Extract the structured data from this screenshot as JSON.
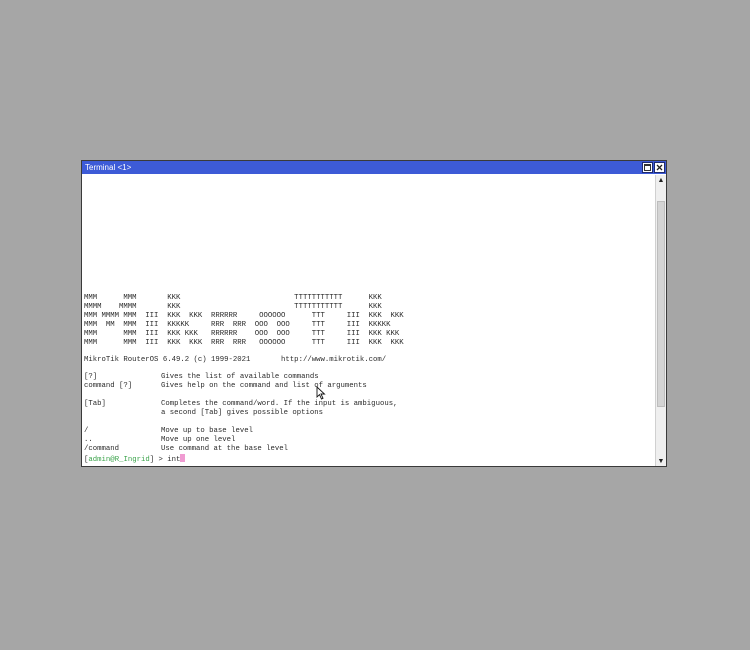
{
  "window": {
    "title": "Terminal <1>"
  },
  "banner": [
    "MMM      MMM       KKK                          TTTTTTTTTTT      KKK",
    "MMMM    MMMM       KKK                          TTTTTTTTTTT      KKK",
    "MMM MMMM MMM  III  KKK  KKK  RRRRRR     OOOOOO      TTT     III  KKK  KKK",
    "MMM  MM  MMM  III  KKKKK     RRR  RRR  OOO  OOO     TTT     III  KKKKK",
    "MMM      MMM  III  KKK KKK   RRRRRR    OOO  OOO     TTT     III  KKK KKK",
    "MMM      MMM  III  KKK  KKK  RRR  RRR   OOOOOO      TTT     III  KKK  KKK"
  ],
  "version_line": "MikroTik RouterOS 6.49.2 (c) 1999-2021       http://www.mikrotik.com/",
  "help": [
    {
      "key": "[?]",
      "desc": "Gives the list of available commands"
    },
    {
      "key": "command [?]",
      "desc": "Gives help on the command and list of arguments"
    },
    {
      "key": "",
      "desc": ""
    },
    {
      "key": "[Tab]",
      "desc": "Completes the command/word. If the input is ambiguous,"
    },
    {
      "key": "",
      "desc": "a second [Tab] gives possible options"
    },
    {
      "key": "",
      "desc": ""
    },
    {
      "key": "/",
      "desc": "Move up to base level"
    },
    {
      "key": "..",
      "desc": "Move up one level"
    },
    {
      "key": "/command",
      "desc": "Use command at the base level"
    }
  ],
  "prompt": {
    "open": "[",
    "user": "admin",
    "at": "@",
    "host": "R_Ingrid",
    "close": "] > ",
    "input": "int"
  },
  "colors": {
    "titlebar": "#3d5bd7",
    "prompt_green": "#3aa34a",
    "cursor": "#f09bd2",
    "background": "#a6a6a6"
  },
  "icons": {
    "maximize": "maximize-icon",
    "close": "close-icon",
    "scroll_up": "scroll-up-arrow-icon",
    "scroll_down": "scroll-down-arrow-icon"
  }
}
